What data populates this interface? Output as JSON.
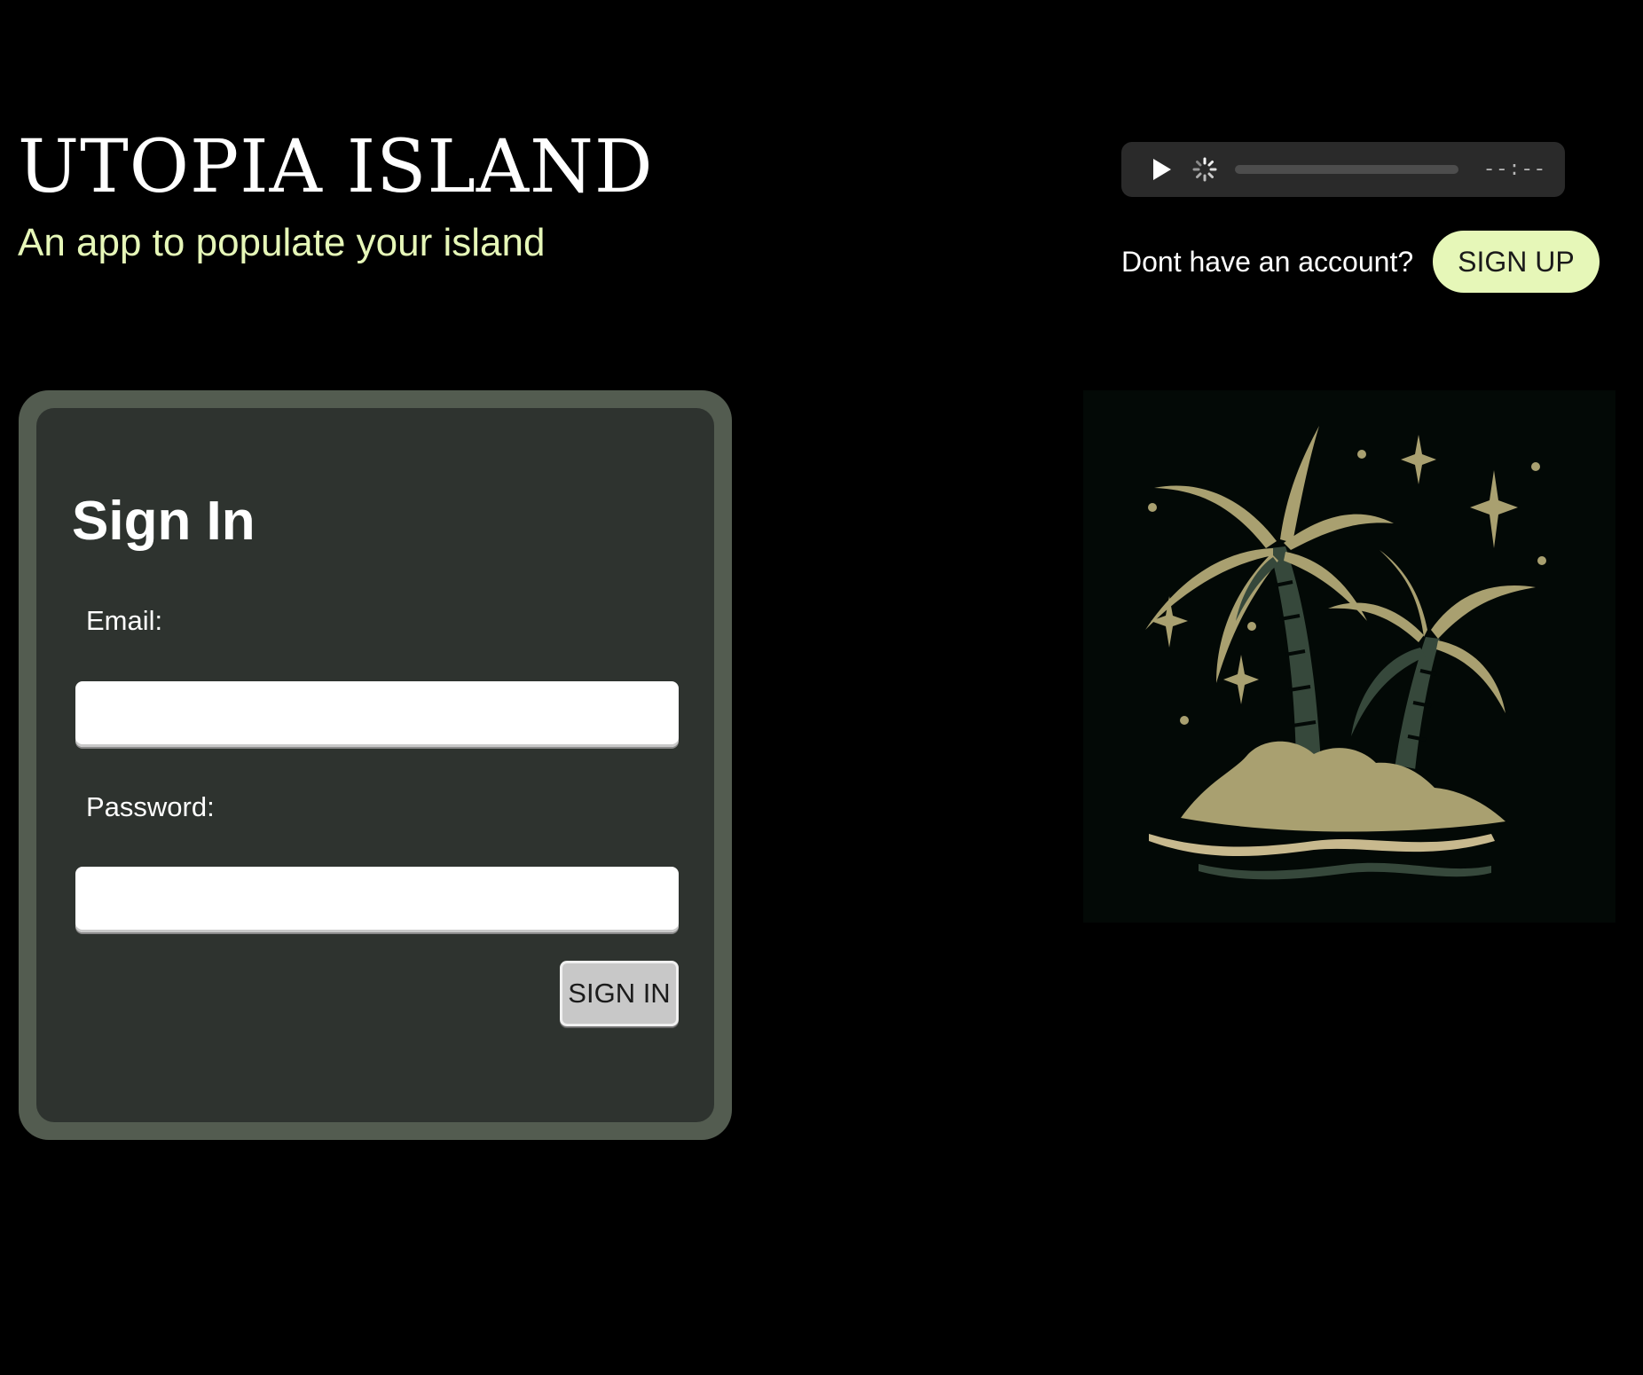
{
  "header": {
    "title": "UTOPIA ISLAND",
    "subtitle": "An app to populate your island"
  },
  "audio_player": {
    "time": "--:--",
    "progress": 0
  },
  "signup": {
    "prompt": "Dont have an account?",
    "button_label": "SIGN UP"
  },
  "signin_form": {
    "title": "Sign In",
    "email_label": "Email:",
    "email_value": "",
    "password_label": "Password:",
    "password_value": "",
    "submit_label": "SIGN IN"
  },
  "colors": {
    "background": "#000000",
    "accent": "#e6f7b8",
    "card_border": "#535c50",
    "card_body": "#2e332f",
    "illustration_gold": "#a9a070",
    "illustration_green": "#36483b"
  },
  "icons": {
    "play": "play-icon",
    "loading": "loading-spinner-icon",
    "illustration": "palm-island-illustration"
  }
}
